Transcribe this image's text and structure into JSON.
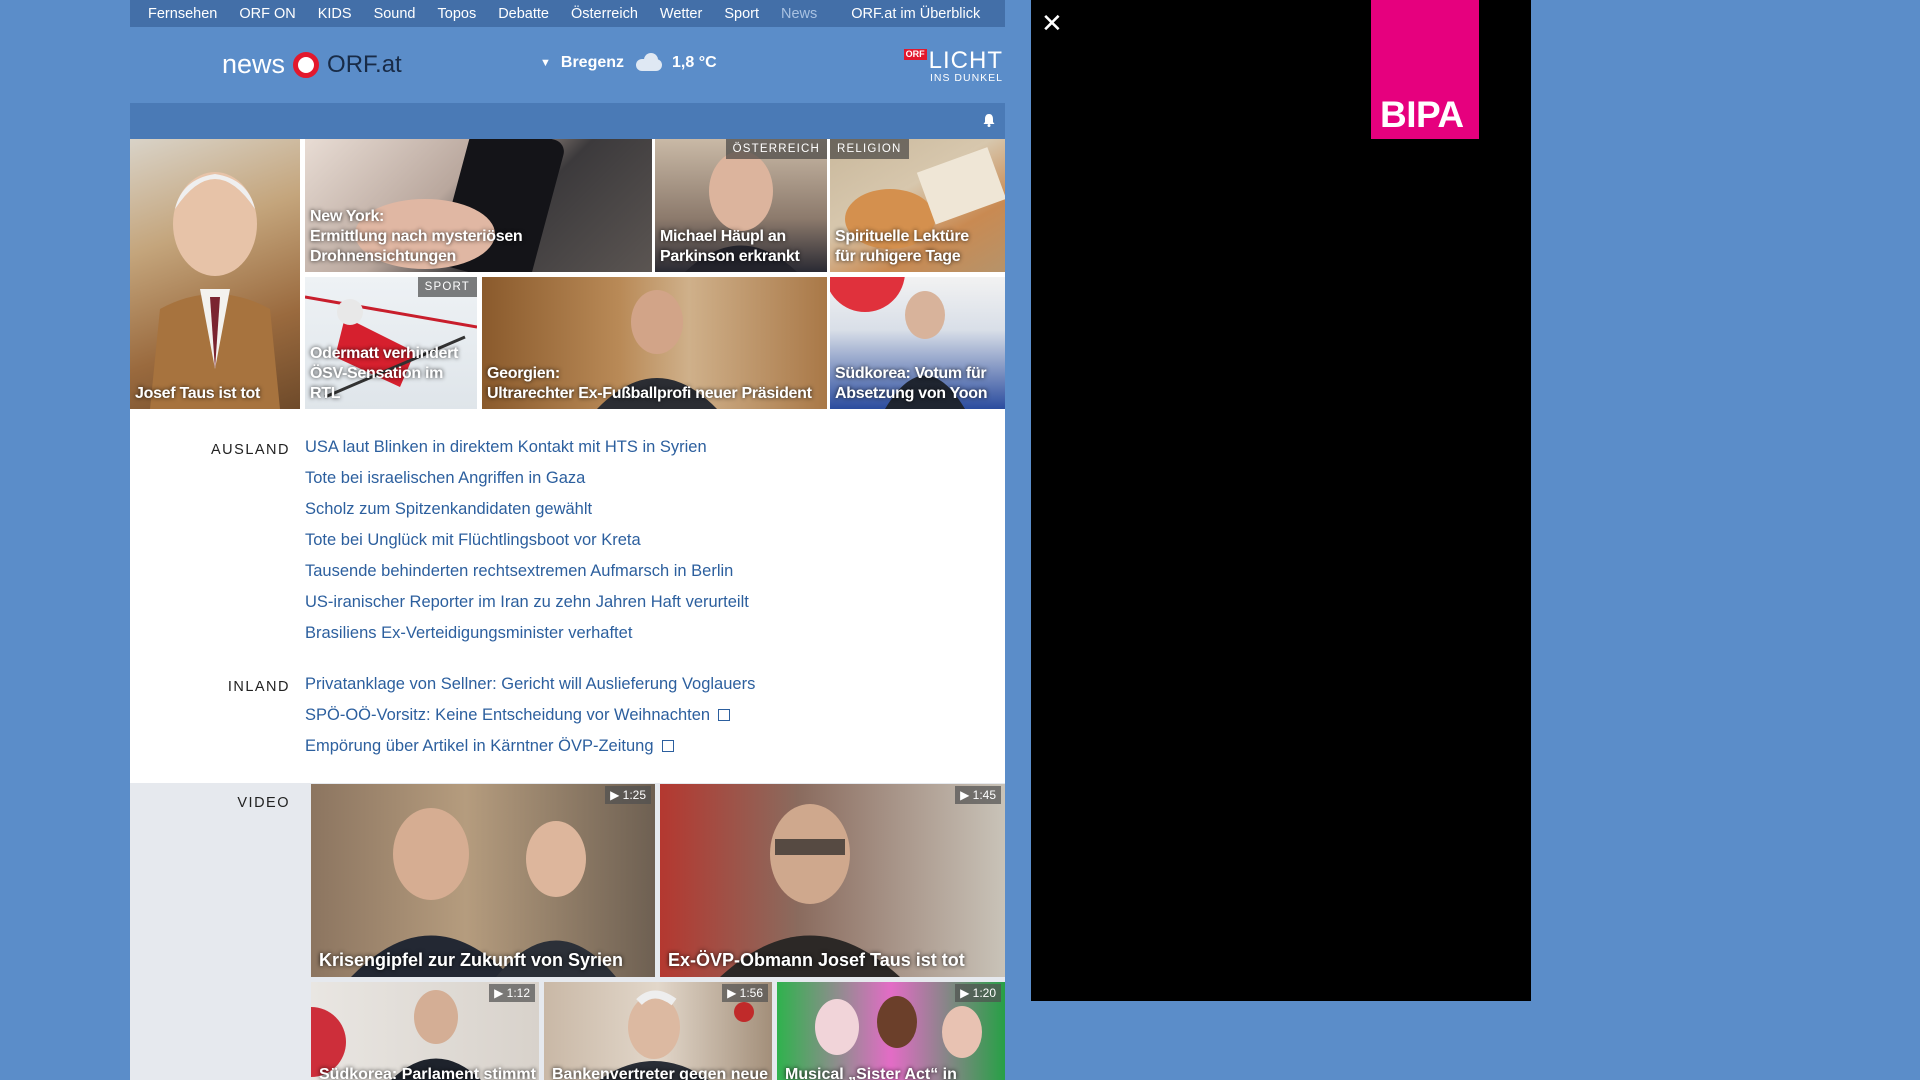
{
  "nav": {
    "items": [
      "Fernsehen",
      "ORF ON",
      "KIDS",
      "Sound",
      "Topos",
      "Debatte",
      "Österreich",
      "Wetter",
      "Sport",
      "News"
    ],
    "overview": "ORF.at im Überblick"
  },
  "header": {
    "logo_news": "news",
    "logo_orf": "ORF.at",
    "weather_city": "Bregenz",
    "weather_temp": "1,8 °C",
    "campaign_badge": "ORF",
    "campaign_title": "LICHT",
    "campaign_sub": "INS DUNKEL"
  },
  "tiles": [
    {
      "caption": "Josef Taus ist tot",
      "tag": ""
    },
    {
      "caption": "New York:\nErmittlung nach mysteriösen Drohnensichtungen",
      "tag": ""
    },
    {
      "caption": "Michael Häupl an\nParkinson erkrankt",
      "tag": "ÖSTERREICH"
    },
    {
      "caption": "Spirituelle Lektüre\nfür ruhigere Tage",
      "tag": "RELIGION"
    },
    {
      "caption": "Odermatt verhindert\nÖSV-Sensation im RTL",
      "tag": "SPORT"
    },
    {
      "caption": "Georgien:\nUltrarechter Ex-Fußballprofi neuer Präsident",
      "tag": ""
    },
    {
      "caption": "Südkorea: Votum für\nAbsetzung von Yoon",
      "tag": ""
    }
  ],
  "ausland": {
    "label": "AUSLAND",
    "links": [
      "USA laut Blinken in direktem Kontakt mit HTS in Syrien",
      "Tote bei israelischen Angriffen in Gaza",
      "Scholz zum Spitzenkandidaten gewählt",
      "Tote bei Unglück mit Flüchtlingsboot vor Kreta",
      "Tausende behinderten rechtsextremen Aufmarsch in Berlin",
      "US-iranischer Reporter im Iran zu zehn Jahren Haft verurteilt",
      "Brasiliens Ex-Verteidigungsminister verhaftet"
    ]
  },
  "inland": {
    "label": "INLAND",
    "links": [
      "Privatanklage von Sellner: Gericht will Auslieferung Voglauers",
      "SPÖ-OÖ-Vorsitz: Keine Entscheidung vor Weihnachten",
      "Empörung über Artikel in Kärntner ÖVP-Zeitung"
    ]
  },
  "video": {
    "label": "VIDEO",
    "items": [
      {
        "caption": "Krisengipfel zur Zukunft von Syrien",
        "duration": "1:25"
      },
      {
        "caption": "Ex-ÖVP-Obmann Josef Taus ist tot",
        "duration": "1:45"
      },
      {
        "caption": "Südkorea: Parlament stimmt",
        "duration": "1:12"
      },
      {
        "caption": "Bankenvertreter gegen neue",
        "duration": "1:56"
      },
      {
        "caption": "Musical „Sister Act“ in",
        "duration": "1:20"
      }
    ]
  },
  "ad": {
    "brand": "BIPA",
    "close_icon": "close-icon",
    "brand_color": "#e6007e"
  }
}
